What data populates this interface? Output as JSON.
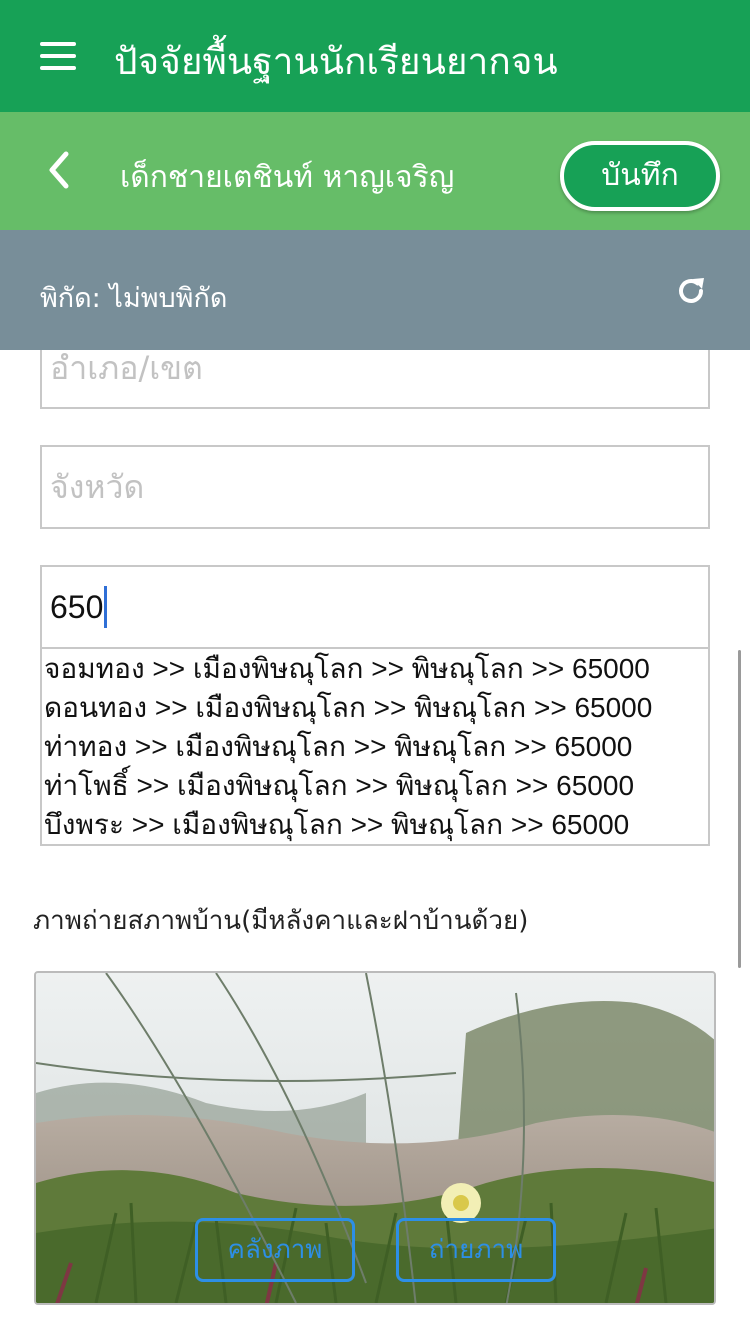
{
  "app": {
    "title": "ปัจจัยพื้นฐานนักเรียนยากจน",
    "menu_icon": "hamburger-menu-icon"
  },
  "student": {
    "name": "เด็กชายเตชินท์ หาญเจริญ",
    "back_icon": "chevron-left-icon",
    "save_label": "บันทึก"
  },
  "location": {
    "text": "พิกัด: ไม่พบพิกัด",
    "refresh_icon": "refresh-icon"
  },
  "form": {
    "district_placeholder": "อำเภอ/เขต",
    "province_placeholder": "จังหวัด",
    "postcode_value": "650"
  },
  "suggestions": [
    "จอมทอง >> เมืองพิษณุโลก >> พิษณุโลก >> 65000",
    "ดอนทอง >> เมืองพิษณุโลก >> พิษณุโลก >> 65000",
    "ท่าทอง >> เมืองพิษณุโลก >> พิษณุโลก >> 65000",
    "ท่าโพธิ์ >> เมืองพิษณุโลก >> พิษณุโลก >> 65000",
    "บึงพระ >> เมืองพิษณุโลก >> พิษณุโลก >> 65000"
  ],
  "photo_section": {
    "label": "ภาพถ่ายสภาพบ้าน(มีหลังคาและฝาบ้านด้วย)",
    "gallery_label": "คลังภาพ",
    "camera_label": "ถ่ายภาพ"
  },
  "colors": {
    "appbar": "#17a156",
    "subbar": "#66bd68",
    "coordbar": "#788e99",
    "accent_blue": "#2d8fe6"
  }
}
